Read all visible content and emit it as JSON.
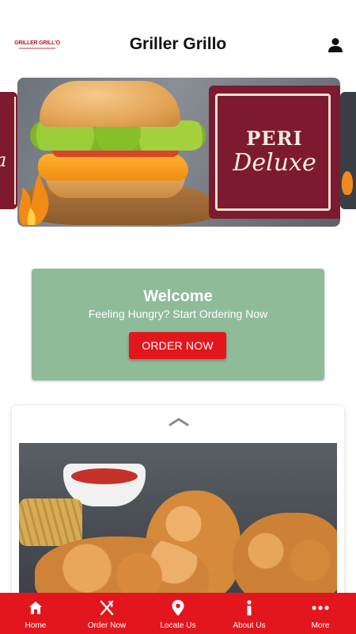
{
  "header": {
    "logo_text": "GRILLER GRILL'O",
    "title": "Griller Grillo",
    "profile_icon": "person-icon"
  },
  "carousel": {
    "current_slide": {
      "promo_line1": "PERI",
      "promo_line2": "Deluxe"
    },
    "prev_slide_partial_text": "a"
  },
  "welcome": {
    "title": "Welcome",
    "subtitle": "Feeling Hungry? Start Ordering Now",
    "button_label": "ORDER NOW"
  },
  "menu_card": {
    "chevron_icon": "chevron-up-icon"
  },
  "bottom_nav": {
    "items": [
      {
        "label": "Home",
        "icon": "home-icon"
      },
      {
        "label": "Order Now",
        "icon": "fork-knife-icon"
      },
      {
        "label": "Locate Us",
        "icon": "location-pin-icon"
      },
      {
        "label": "About Us",
        "icon": "info-icon"
      },
      {
        "label": "More",
        "icon": "more-dots-icon"
      }
    ]
  },
  "colors": {
    "brand_red": "#e3161d",
    "welcome_green": "#8fbb99",
    "promo_maroon": "#7d1a2f"
  }
}
